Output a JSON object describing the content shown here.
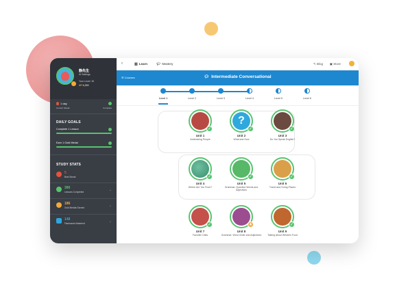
{
  "profile": {
    "name": "静先生",
    "settings_label": "⚙ Settings",
    "level_text": "Your Level: 30",
    "xp_value": "XP",
    "xp_text": "6,293"
  },
  "streak": {
    "label": "1 day",
    "sub": "Current Streak",
    "complete": "Complete"
  },
  "daily_goals": {
    "title": "DAILY GOALS",
    "items": [
      {
        "label": "Complete 1 Lesson",
        "progress": 1.0
      },
      {
        "label": "Earn 1 Gold Medal",
        "progress": 1.0
      }
    ]
  },
  "study_stats": {
    "title": "STUDY STATS",
    "items": [
      {
        "value": "5",
        "label": "Best Streak",
        "color": "#e4533d"
      },
      {
        "value": "390",
        "label": "Lessons Completed",
        "color": "#57c470"
      },
      {
        "value": "186",
        "label": "Gold Medals Earned",
        "color": "#f2a93b"
      },
      {
        "value": "148",
        "label": "Flashcards Mastered",
        "color": "#2ea6dd"
      }
    ]
  },
  "topbar": {
    "back": "‹",
    "learn": "Learn",
    "mastery": "Mastery",
    "blog": "Blog",
    "store": "Store"
  },
  "course": {
    "courses_link": "☰ Courses",
    "title": "Intermediate Conversational"
  },
  "levels": [
    "Level 1",
    "Level 2",
    "Level 3",
    "Level 4",
    "Level 5",
    "Level 6"
  ],
  "units": [
    {
      "title": "Unit 1",
      "sub": "Addressing People",
      "color": "#b74b43"
    },
    {
      "title": "Unit 2",
      "sub": "What and How",
      "color": "#2fa9dd"
    },
    {
      "title": "Unit 3",
      "sub": "Do You Speak English?",
      "color": "#6b4a3f"
    },
    {
      "title": "Unit 4",
      "sub": "Where Are You From?",
      "color": "#3a8f6e"
    },
    {
      "title": "Unit 5",
      "sub": "Grammar: Question Words and Adjectives",
      "color": "#57b868"
    },
    {
      "title": "Unit 6",
      "sub": "Travel and Going Places",
      "color": "#d9a049"
    },
    {
      "title": "Unit 7",
      "sub": "Favorite Cities",
      "color": "#c4514a"
    },
    {
      "title": "Unit 8",
      "sub": "Grammar: Word Order and Adjectives",
      "color": "#9b4d8f"
    },
    {
      "title": "Unit 9",
      "sub": "Talking About Western Food",
      "color": "#c0662f"
    }
  ],
  "colors": {
    "sidebar": "#393d44",
    "accent_blue": "#1d87d0",
    "success_green": "#57c470"
  }
}
